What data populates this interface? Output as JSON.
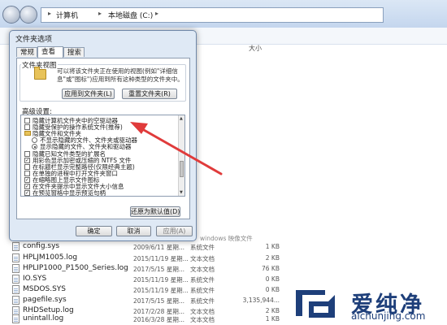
{
  "explorer": {
    "breadcrumbs": [
      "计算机",
      "本地磁盘 (C:)"
    ],
    "column_size": "大小",
    "background_fragments": [
      "windows 映像文件"
    ],
    "files": [
      {
        "name": "config.sys",
        "date": "2009/6/11 星期...",
        "type": "系统文件",
        "size": "1 KB"
      },
      {
        "name": "HPLJM1005.log",
        "date": "2015/11/19 星期...",
        "type": "文本文档",
        "size": "2 KB"
      },
      {
        "name": "HPLIP1000_P1500_Series.log",
        "date": "2017/5/15 星期...",
        "type": "文本文档",
        "size": "76 KB"
      },
      {
        "name": "IO.SYS",
        "date": "2015/11/19 星期...",
        "type": "系统文件",
        "size": "0 KB"
      },
      {
        "name": "MSDOS.SYS",
        "date": "2015/11/19 星期...",
        "type": "系统文件",
        "size": "0 KB"
      },
      {
        "name": "pagefile.sys",
        "date": "2017/5/15 星期...",
        "type": "系统文件",
        "size": "3,135,944..."
      },
      {
        "name": "RHDSetup.log",
        "date": "2017/2/28 星期...",
        "type": "文本文档",
        "size": "2 KB"
      },
      {
        "name": "unintall.log",
        "date": "2016/3/28 星期...",
        "type": "文本文档",
        "size": "1 KB"
      }
    ]
  },
  "dialog": {
    "title": "文件夹选项",
    "tabs": [
      "常规",
      "查看",
      "搜索"
    ],
    "folder_views_title": "文件夹视图",
    "folder_views_desc": "可以将该文件夹正在使用的视图(例如\"详细信息\"或\"图标\")应用到所有这种类型的文件夹中。",
    "apply_to_folders": "应用到文件夹(L)",
    "reset_folders": "重置文件夹(R)",
    "advanced_label": "高级设置:",
    "advanced_items": [
      {
        "kind": "checkbox",
        "checked": false,
        "indent": 0,
        "text": "隐藏计算机文件夹中的空驱动器"
      },
      {
        "kind": "checkbox",
        "checked": false,
        "indent": 0,
        "text": "隐藏受保护的操作系统文件(推荐)"
      },
      {
        "kind": "folder",
        "checked": false,
        "indent": 0,
        "text": "隐藏文件和文件夹"
      },
      {
        "kind": "radio",
        "checked": false,
        "indent": 1,
        "text": "不显示隐藏的文件、文件夹或驱动器"
      },
      {
        "kind": "radio",
        "checked": true,
        "indent": 1,
        "text": "显示隐藏的文件、文件夹和驱动器"
      },
      {
        "kind": "checkbox",
        "checked": false,
        "indent": 0,
        "text": "隐藏已知文件类型的扩展名"
      },
      {
        "kind": "checkbox",
        "checked": true,
        "indent": 0,
        "text": "用彩色显示加密或压缩的 NTFS 文件"
      },
      {
        "kind": "checkbox",
        "checked": false,
        "indent": 0,
        "text": "在标题栏显示完整路径(仅限经典主题)"
      },
      {
        "kind": "checkbox",
        "checked": false,
        "indent": 0,
        "text": "在单独的进程中打开文件夹窗口"
      },
      {
        "kind": "checkbox",
        "checked": true,
        "indent": 0,
        "text": "在缩略图上显示文件图标"
      },
      {
        "kind": "checkbox",
        "checked": true,
        "indent": 0,
        "text": "在文件夹提示中显示文件大小信息"
      },
      {
        "kind": "checkbox",
        "checked": true,
        "indent": 0,
        "text": "在预览窗格中显示预览句柄"
      }
    ],
    "check_mark": "✓",
    "restore_defaults": "还原为默认值(D)",
    "ok": "确定",
    "cancel": "取消",
    "apply": "应用(A)"
  },
  "watermark": {
    "name": "爱纯净",
    "url": "aichunjing.com"
  },
  "colors": {
    "accent_red": "#e03b3b",
    "brand_blue": "#1e3f7a"
  }
}
